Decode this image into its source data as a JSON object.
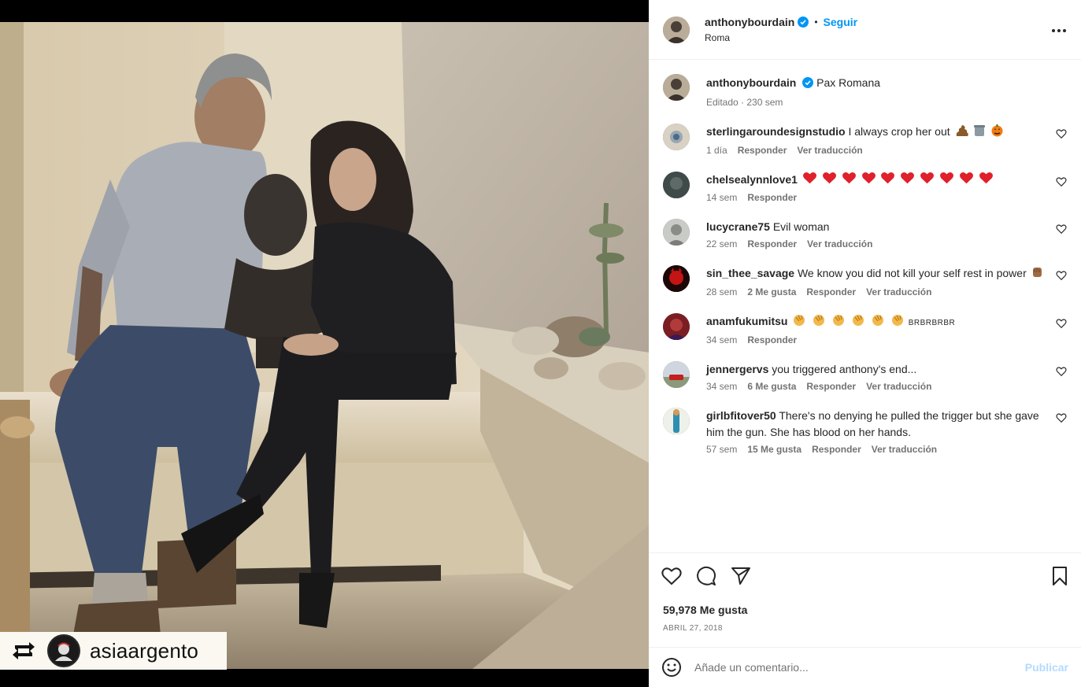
{
  "photo": {
    "repost": {
      "handle": "asiaargento"
    }
  },
  "post": {
    "author": "anthonybourdain",
    "follow_label": "Seguir",
    "location": "Roma",
    "more_icon": "more-options-icon",
    "caption": {
      "author": "anthonybourdain",
      "text": "Pax Romana",
      "meta": "Editado · 230 sem"
    },
    "comments": [
      {
        "user": "sterlingaroundesignstudio",
        "text": "I always crop her out",
        "emojis": [
          "poop",
          "trash-can",
          "jack-o-lantern"
        ],
        "time": "1 día",
        "likes": "",
        "reply": "Responder",
        "translate": "Ver traducción"
      },
      {
        "user": "chelsealynnlove1",
        "text": "",
        "emojis": [
          "heart",
          "heart",
          "heart",
          "heart",
          "heart",
          "heart",
          "heart",
          "heart",
          "heart",
          "heart"
        ],
        "time": "14 sem",
        "likes": "",
        "reply": "Responder",
        "translate": ""
      },
      {
        "user": "lucycrane75",
        "text": "Evil woman",
        "emojis": [],
        "time": "22 sem",
        "likes": "",
        "reply": "Responder",
        "translate": "Ver traducción"
      },
      {
        "user": "sin_thee_savage",
        "text": "We know you did not kill your self rest in power",
        "emojis": [
          "raised-fist"
        ],
        "time": "28 sem",
        "likes": "2 Me gusta",
        "reply": "Responder",
        "translate": "Ver traducción"
      },
      {
        "user": "anamfukumitsu",
        "text": "",
        "emojis": [
          "clap",
          "clap",
          "clap",
          "clap",
          "clap",
          "clap"
        ],
        "suffix": "BRBRBRBR",
        "time": "34 sem",
        "likes": "",
        "reply": "Responder",
        "translate": ""
      },
      {
        "user": "jennergervs",
        "text": "you triggered anthony's end...",
        "emojis": [],
        "time": "34 sem",
        "likes": "6 Me gusta",
        "reply": "Responder",
        "translate": "Ver traducción"
      },
      {
        "user": "girlbfitover50",
        "text": "There's no denying he pulled the trigger but she gave him the gun. She has blood on her hands.",
        "emojis": [],
        "time": "57 sem",
        "likes": "15 Me gusta",
        "reply": "Responder",
        "translate": "Ver traducción"
      }
    ],
    "likes_count": "59,978 Me gusta",
    "date": "ABRIL 27, 2018",
    "add_comment": {
      "placeholder": "Añade un comentario...",
      "publish_label": "Publicar"
    },
    "colors": {
      "accent": "#0095f6",
      "verified": "#0095f6",
      "muted": "#737373",
      "heart_emoji": "#e0202b",
      "publish_disabled": "#b3dbff"
    }
  }
}
